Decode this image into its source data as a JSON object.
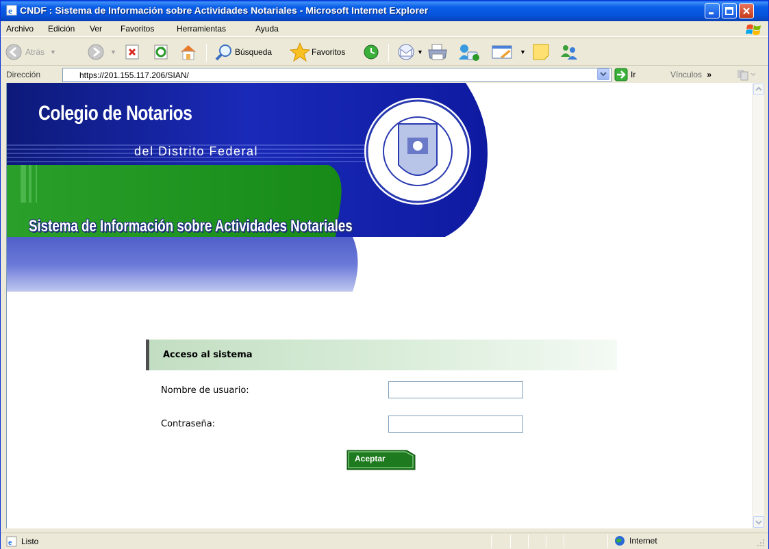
{
  "window": {
    "title": "CNDF : Sistema de Información sobre Actividades Notariales - Microsoft Internet Explorer"
  },
  "menu": {
    "items": [
      {
        "label": "Archivo"
      },
      {
        "label": "Edición"
      },
      {
        "label": "Ver"
      },
      {
        "label": "Favoritos"
      },
      {
        "label": "Herramientas"
      },
      {
        "label": "Ayuda"
      }
    ]
  },
  "toolbar": {
    "back_label": "Atrás",
    "search_label": "Búsqueda",
    "favorites_label": "Favoritos"
  },
  "address": {
    "label": "Dirección",
    "url": "https://201.155.117.206/SIAN/",
    "go_label": "Ir",
    "links_label": "Vínculos"
  },
  "banner": {
    "title": "Colegio de Notarios",
    "subtitle": "del Distrito Federal",
    "system_title": "Sistema de Información sobre Actividades Notariales",
    "seal_text": "COLEGIO DE NOTARIOS DEL DISTRITO FEDERAL"
  },
  "login": {
    "header": "Acceso al sistema",
    "username_label": "Nombre de usuario:",
    "username_value": "",
    "password_label": "Contraseña:",
    "password_value": "",
    "submit_label": "Aceptar"
  },
  "status": {
    "text": "Listo",
    "zone": "Internet"
  },
  "colors": {
    "titlebar": "#0653dc",
    "banner_blue": "#1a2aa0",
    "banner_green": "#1b8f1b",
    "button_green": "#1e7a1e"
  }
}
